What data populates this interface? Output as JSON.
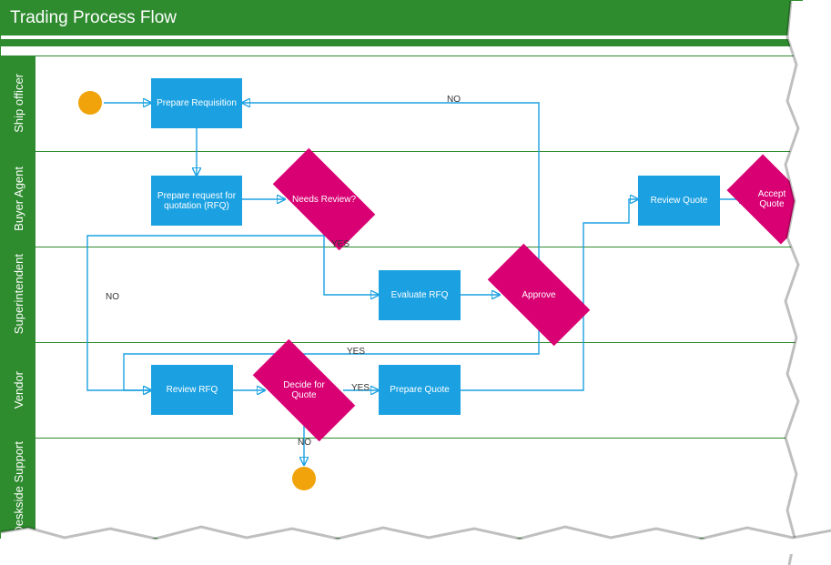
{
  "title": "Trading Process Flow",
  "lanes": {
    "l1": "Ship officer",
    "l2": "Buyer Agent",
    "l3": "Superintendent",
    "l4": "Vendor",
    "l5": "Deskside Support"
  },
  "nodes": {
    "prepReq": "Prepare Requisition",
    "prepRFQ": "Prepare request for quotation (RFQ)",
    "needsReview": "Needs Review?",
    "evalRFQ": "Evaluate RFQ",
    "approve": "Approve",
    "reviewRFQ": "Review RFQ",
    "decideQuote": "Decide for Quote",
    "prepQuote": "Prepare Quote",
    "reviewQuote": "Review Quote",
    "acceptQuote": "Accept Quote"
  },
  "edgeLabels": {
    "noTop": "NO",
    "yesReview": "YES",
    "yesApprove": "YES",
    "noApprove": "NO",
    "yesDecide": "YES",
    "noDecide": "NO"
  },
  "colors": {
    "lane": "#2e8b2e",
    "process": "#1ba1e2",
    "decision": "#d80073",
    "terminal": "#f0a30a"
  },
  "chart_data": {
    "type": "swimlane-flowchart",
    "title": "Trading Process Flow",
    "lanes": [
      "Ship officer",
      "Buyer Agent",
      "Superintendent",
      "Vendor",
      "Deskside Support"
    ],
    "nodes": [
      {
        "id": "start",
        "type": "start",
        "lane": "Ship officer"
      },
      {
        "id": "prepReq",
        "type": "process",
        "lane": "Ship officer",
        "label": "Prepare Requisition"
      },
      {
        "id": "prepRFQ",
        "type": "process",
        "lane": "Buyer Agent",
        "label": "Prepare request for quotation (RFQ)"
      },
      {
        "id": "needsReview",
        "type": "decision",
        "lane": "Buyer Agent",
        "label": "Needs Review?"
      },
      {
        "id": "evalRFQ",
        "type": "process",
        "lane": "Superintendent",
        "label": "Evaluate RFQ"
      },
      {
        "id": "approve",
        "type": "decision",
        "lane": "Superintendent",
        "label": "Approve"
      },
      {
        "id": "reviewRFQ",
        "type": "process",
        "lane": "Vendor",
        "label": "Review RFQ"
      },
      {
        "id": "decideQuote",
        "type": "decision",
        "lane": "Vendor",
        "label": "Decide for Quote"
      },
      {
        "id": "prepQuote",
        "type": "process",
        "lane": "Vendor",
        "label": "Prepare Quote"
      },
      {
        "id": "reviewQuote",
        "type": "process",
        "lane": "Buyer Agent",
        "label": "Review Quote"
      },
      {
        "id": "acceptQuote",
        "type": "decision",
        "lane": "Buyer Agent",
        "label": "Accept Quote"
      },
      {
        "id": "end",
        "type": "end",
        "lane": "Deskside Support"
      }
    ],
    "edges": [
      {
        "from": "start",
        "to": "prepReq"
      },
      {
        "from": "prepReq",
        "to": "prepRFQ"
      },
      {
        "from": "prepRFQ",
        "to": "needsReview"
      },
      {
        "from": "needsReview",
        "to": "evalRFQ",
        "label": "YES"
      },
      {
        "from": "needsReview",
        "to": "reviewRFQ",
        "label": "NO"
      },
      {
        "from": "evalRFQ",
        "to": "approve"
      },
      {
        "from": "approve",
        "to": "prepReq",
        "label": "NO"
      },
      {
        "from": "approve",
        "to": "reviewRFQ",
        "label": "YES"
      },
      {
        "from": "reviewRFQ",
        "to": "decideQuote"
      },
      {
        "from": "decideQuote",
        "to": "prepQuote",
        "label": "YES"
      },
      {
        "from": "decideQuote",
        "to": "end",
        "label": "NO"
      },
      {
        "from": "prepQuote",
        "to": "reviewQuote"
      },
      {
        "from": "reviewQuote",
        "to": "acceptQuote"
      }
    ]
  }
}
